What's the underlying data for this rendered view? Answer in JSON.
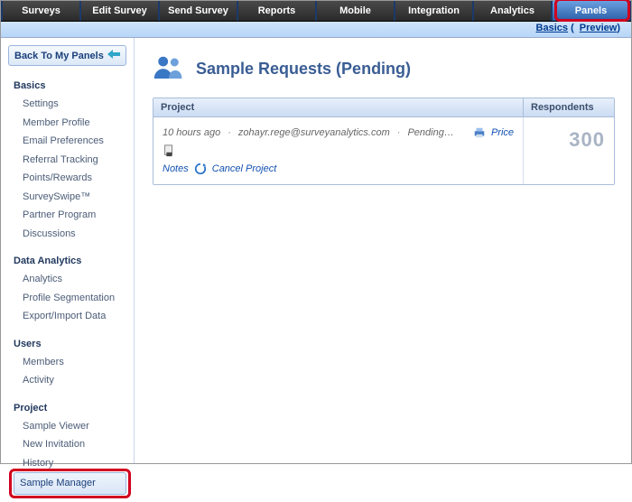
{
  "topnav": {
    "tabs": [
      {
        "label": "Surveys"
      },
      {
        "label": "Edit Survey"
      },
      {
        "label": "Send Survey"
      },
      {
        "label": "Reports"
      },
      {
        "label": "Mobile"
      },
      {
        "label": "Integration"
      },
      {
        "label": "Analytics"
      },
      {
        "label": "Panels",
        "active": true
      }
    ]
  },
  "subbar": {
    "link1": "Basics",
    "link2": "Preview"
  },
  "sidebar": {
    "back_label": "Back To My Panels",
    "sections": [
      {
        "title": "Basics",
        "items": [
          "Settings",
          "Member Profile",
          "Email Preferences",
          "Referral Tracking",
          "Points/Rewards",
          "SurveySwipe™",
          "Partner Program",
          "Discussions"
        ]
      },
      {
        "title": "Data Analytics",
        "items": [
          "Analytics",
          "Profile Segmentation",
          "Export/Import Data"
        ]
      },
      {
        "title": "Users",
        "items": [
          "Members",
          "Activity"
        ]
      },
      {
        "title": "Project",
        "items": [
          "Sample Viewer",
          "New Invitation",
          "History",
          "Sample Manager"
        ]
      }
    ],
    "selected": "Sample Manager"
  },
  "page": {
    "title": "Sample Requests (Pending)",
    "columns": {
      "project": "Project",
      "respondents": "Respondents"
    },
    "row": {
      "time": "10 hours ago",
      "email": "zohayr.rege@surveyanalytics.com",
      "status": "Pending…",
      "price": "Price",
      "notes": "Notes",
      "cancel": "Cancel Project",
      "respondents": "300"
    }
  }
}
